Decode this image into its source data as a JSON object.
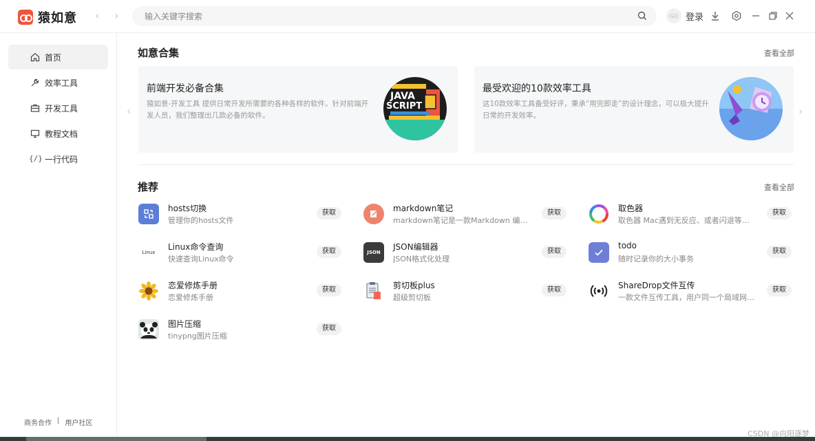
{
  "app": {
    "name": "猿如意"
  },
  "search": {
    "placeholder": "输入关键字搜索"
  },
  "header": {
    "login_label": "登录",
    "login_avatar_text": "GO"
  },
  "sidebar": {
    "items": [
      {
        "label": "首页",
        "icon": "home-icon",
        "active": true
      },
      {
        "label": "效率工具",
        "icon": "wrench-icon"
      },
      {
        "label": "开发工具",
        "icon": "toolbox-icon"
      },
      {
        "label": "教程文档",
        "icon": "monitor-icon"
      },
      {
        "label": "一行代码",
        "icon": "code-icon",
        "glyph": "{/}"
      }
    ],
    "footer": {
      "business": "商务合作",
      "separator": "|",
      "community": "用户社区"
    }
  },
  "collection": {
    "title": "如意合集",
    "see_all": "查看全部",
    "cards": [
      {
        "title": "前端开发必备合集",
        "desc": "猿如意-开发工具 提供日常开发所需要的各种各样的软件。针对前端开发人员，我们整理出几款必备的软件。",
        "art_text_1": "JAVA",
        "art_text_2": "SCRIPT"
      },
      {
        "title": "最受欢迎的10款效率工具",
        "desc": "这10款效率工具备受好评，秉承“用完即走”的设计理念，可以极大提升日常的开发效率。"
      }
    ]
  },
  "recommend": {
    "title": "推荐",
    "see_all": "查看全部",
    "get_label": "获取",
    "apps": [
      {
        "name": "hosts切换",
        "desc": "管理你的hosts文件",
        "icon": "hosts-switch-icon"
      },
      {
        "name": "markdown笔记",
        "desc": "markdown笔记是一款Markdown 编辑器...",
        "icon": "markdown-note-icon"
      },
      {
        "name": "取色器",
        "desc": "取色器 Mac遇到无反应、或者闪退等情...",
        "icon": "color-picker-icon"
      },
      {
        "name": "Linux命令查询",
        "desc": "快速查询Linux命令",
        "icon": "linux-icon",
        "icon_text": "Linux"
      },
      {
        "name": "JSON编辑器",
        "desc": "JSON格式化处理",
        "icon": "json-icon",
        "icon_text": "JSON"
      },
      {
        "name": "todo",
        "desc": "随时记录你的大小事务",
        "icon": "todo-check-icon"
      },
      {
        "name": "恋爱修炼手册",
        "desc": "恋爱修炼手册",
        "icon": "sunflower-icon"
      },
      {
        "name": "剪切板plus",
        "desc": "超级剪切板",
        "icon": "clipboard-icon"
      },
      {
        "name": "ShareDrop文件互传",
        "desc": "一款文件互传工具，用户同一个局域网内...",
        "icon": "sharedrop-icon"
      },
      {
        "name": "图片压缩",
        "desc": "tinypng图片压缩",
        "icon": "panda-icon"
      }
    ]
  },
  "watermark": "CSDN @向阳逐梦",
  "colors": {
    "brand": "#f0543c",
    "hosts": "#5b7fd6",
    "todo": "#6f7fd6",
    "json": "#3b3b3b"
  }
}
